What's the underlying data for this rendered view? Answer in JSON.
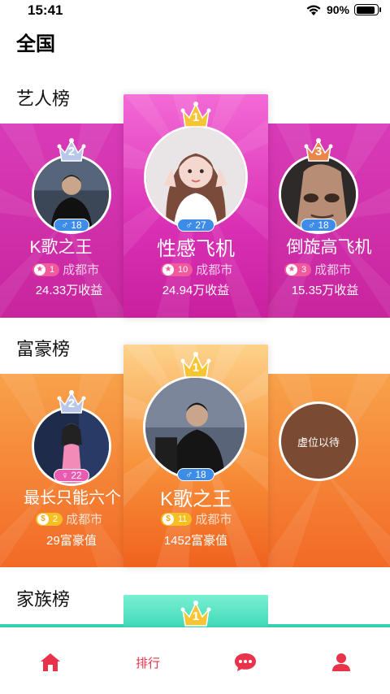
{
  "status": {
    "time": "15:41",
    "battery": "90%"
  },
  "page_title": "全国",
  "colors": {
    "accent": "#e8334a",
    "gender": "#3d8de8"
  },
  "boards": [
    {
      "title": "艺人榜",
      "entries": [
        {
          "position": 1,
          "crown_number": "1",
          "name": "性感飞机",
          "gender_count": "27",
          "rank_level": "10",
          "city": "成都市",
          "stat": "24.94万收益"
        },
        {
          "position": 2,
          "crown_number": "2",
          "name": "K歌之王",
          "gender_count": "18",
          "rank_level": "1",
          "city": "成都市",
          "stat": "24.33万收益"
        },
        {
          "position": 3,
          "crown_number": "3",
          "name": "倒旋高飞机",
          "gender_count": "18",
          "rank_level": "3",
          "city": "成都市",
          "stat": "15.35万收益"
        }
      ]
    },
    {
      "title": "富豪榜",
      "entries": [
        {
          "position": 1,
          "crown_number": "1",
          "name": "K歌之王",
          "gender_count": "18",
          "rank_level": "11",
          "city": "成都市",
          "stat": "1452富豪值"
        },
        {
          "position": 2,
          "crown_number": "2",
          "name": "最长只能六个",
          "gender_count": "22",
          "rank_level": "2",
          "city": "成都市",
          "stat": "29富豪值"
        },
        {
          "position": 3,
          "placeholder": "虚位以待"
        }
      ]
    },
    {
      "title": "家族榜",
      "entries": [
        {
          "position": 1,
          "crown_number": "1"
        }
      ]
    }
  ],
  "tabbar": {
    "items": [
      {
        "icon": "home-icon"
      },
      {
        "label": "排行"
      },
      {
        "icon": "chat-icon"
      },
      {
        "icon": "user-icon"
      }
    ]
  }
}
